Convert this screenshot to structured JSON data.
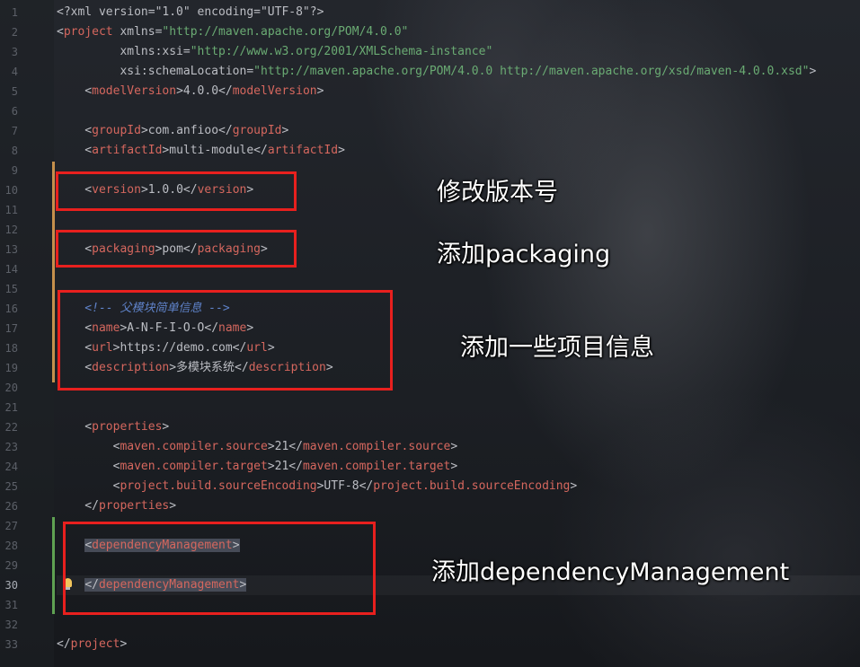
{
  "editor": {
    "active_line": 30,
    "lines": [
      {
        "n": "1",
        "t": [
          {
            "c": "xd",
            "s": "<?xml version=\"1.0\" encoding=\"UTF-8\"?>"
          }
        ]
      },
      {
        "n": "2",
        "t": [
          {
            "c": "xd",
            "s": "<"
          },
          {
            "c": "tag",
            "s": "project"
          },
          {
            "c": "attr",
            "s": " xmlns="
          },
          {
            "c": "val",
            "s": "\"http://maven.apache.org/POM/4.0.0\""
          }
        ]
      },
      {
        "n": "3",
        "t": [
          {
            "c": "attr",
            "s": "         xmlns:xsi="
          },
          {
            "c": "val",
            "s": "\"http://www.w3.org/2001/XMLSchema-instance\""
          }
        ]
      },
      {
        "n": "4",
        "t": [
          {
            "c": "attr",
            "s": "         xsi:schemaLocation="
          },
          {
            "c": "val",
            "s": "\"http://maven.apache.org/POM/4.0.0 http://maven.apache.org/xsd/maven-4.0.0.xsd\""
          },
          {
            "c": "xd",
            "s": ">"
          }
        ]
      },
      {
        "n": "5",
        "t": [
          {
            "c": "xd",
            "s": "    <"
          },
          {
            "c": "tag",
            "s": "modelVersion"
          },
          {
            "c": "xd",
            "s": ">4.0.0</"
          },
          {
            "c": "tag",
            "s": "modelVersion"
          },
          {
            "c": "xd",
            "s": ">"
          }
        ]
      },
      {
        "n": "6",
        "t": []
      },
      {
        "n": "7",
        "t": [
          {
            "c": "xd",
            "s": "    <"
          },
          {
            "c": "tag",
            "s": "groupId"
          },
          {
            "c": "xd",
            "s": ">com.anfioo</"
          },
          {
            "c": "tag",
            "s": "groupId"
          },
          {
            "c": "xd",
            "s": ">"
          }
        ]
      },
      {
        "n": "8",
        "t": [
          {
            "c": "xd",
            "s": "    <"
          },
          {
            "c": "tag",
            "s": "artifactId"
          },
          {
            "c": "xd",
            "s": ">multi-module</"
          },
          {
            "c": "tag",
            "s": "artifactId"
          },
          {
            "c": "xd",
            "s": ">"
          }
        ]
      },
      {
        "n": "9",
        "t": []
      },
      {
        "n": "10",
        "t": [
          {
            "c": "xd",
            "s": "    <"
          },
          {
            "c": "tag",
            "s": "version"
          },
          {
            "c": "xd",
            "s": ">1.0.0</"
          },
          {
            "c": "tag",
            "s": "version"
          },
          {
            "c": "xd",
            "s": ">"
          }
        ]
      },
      {
        "n": "11",
        "t": []
      },
      {
        "n": "12",
        "t": []
      },
      {
        "n": "13",
        "t": [
          {
            "c": "xd",
            "s": "    <"
          },
          {
            "c": "tag",
            "s": "packaging"
          },
          {
            "c": "xd",
            "s": ">pom</"
          },
          {
            "c": "tag",
            "s": "packaging"
          },
          {
            "c": "xd",
            "s": ">"
          }
        ]
      },
      {
        "n": "14",
        "t": []
      },
      {
        "n": "15",
        "t": []
      },
      {
        "n": "16",
        "t": [
          {
            "c": "com",
            "s": "    <!-- 父模块简单信息 -->"
          }
        ]
      },
      {
        "n": "17",
        "t": [
          {
            "c": "xd",
            "s": "    <"
          },
          {
            "c": "tag",
            "s": "name"
          },
          {
            "c": "xd",
            "s": ">A-N-F-I-O-O</"
          },
          {
            "c": "tag",
            "s": "name"
          },
          {
            "c": "xd",
            "s": ">"
          }
        ]
      },
      {
        "n": "18",
        "t": [
          {
            "c": "xd",
            "s": "    <"
          },
          {
            "c": "tag",
            "s": "url"
          },
          {
            "c": "xd",
            "s": ">https://demo.com</"
          },
          {
            "c": "tag",
            "s": "url"
          },
          {
            "c": "xd",
            "s": ">"
          }
        ]
      },
      {
        "n": "19",
        "t": [
          {
            "c": "xd",
            "s": "    <"
          },
          {
            "c": "tag",
            "s": "description"
          },
          {
            "c": "xd",
            "s": ">多模块系统</"
          },
          {
            "c": "tag",
            "s": "description"
          },
          {
            "c": "xd",
            "s": ">"
          }
        ]
      },
      {
        "n": "20",
        "t": []
      },
      {
        "n": "21",
        "t": []
      },
      {
        "n": "22",
        "t": [
          {
            "c": "xd",
            "s": "    <"
          },
          {
            "c": "tag",
            "s": "properties"
          },
          {
            "c": "xd",
            "s": ">"
          }
        ]
      },
      {
        "n": "23",
        "t": [
          {
            "c": "xd",
            "s": "        <"
          },
          {
            "c": "tag",
            "s": "maven.compiler.source"
          },
          {
            "c": "xd",
            "s": ">21</"
          },
          {
            "c": "tag",
            "s": "maven.compiler.source"
          },
          {
            "c": "xd",
            "s": ">"
          }
        ]
      },
      {
        "n": "24",
        "t": [
          {
            "c": "xd",
            "s": "        <"
          },
          {
            "c": "tag",
            "s": "maven.compiler.target"
          },
          {
            "c": "xd",
            "s": ">21</"
          },
          {
            "c": "tag",
            "s": "maven.compiler.target"
          },
          {
            "c": "xd",
            "s": ">"
          }
        ]
      },
      {
        "n": "25",
        "t": [
          {
            "c": "xd",
            "s": "        <"
          },
          {
            "c": "tag",
            "s": "project.build.sourceEncoding"
          },
          {
            "c": "xd",
            "s": ">UTF-8</"
          },
          {
            "c": "tag",
            "s": "project.build.sourceEncoding"
          },
          {
            "c": "xd",
            "s": ">"
          }
        ]
      },
      {
        "n": "26",
        "t": [
          {
            "c": "xd",
            "s": "    </"
          },
          {
            "c": "tag",
            "s": "properties"
          },
          {
            "c": "xd",
            "s": ">"
          }
        ]
      },
      {
        "n": "27",
        "t": []
      },
      {
        "n": "28",
        "t": [
          {
            "c": "xd",
            "s": "    "
          },
          {
            "c": "xd",
            "s": "<",
            "sel": true
          },
          {
            "c": "tag",
            "s": "dependencyManagement",
            "sel": true
          },
          {
            "c": "xd",
            "s": ">",
            "sel": true
          }
        ]
      },
      {
        "n": "29",
        "t": []
      },
      {
        "n": "30",
        "t": [
          {
            "c": "xd",
            "s": "    "
          },
          {
            "c": "xd",
            "s": "</",
            "sel": true
          },
          {
            "c": "tag",
            "s": "dependencyManagement",
            "sel": true
          },
          {
            "c": "xd",
            "s": ">",
            "sel": true
          }
        ]
      },
      {
        "n": "31",
        "t": []
      },
      {
        "n": "32",
        "t": []
      },
      {
        "n": "33",
        "t": [
          {
            "c": "xd",
            "s": "</"
          },
          {
            "c": "tag",
            "s": "project"
          },
          {
            "c": "xd",
            "s": ">"
          }
        ]
      }
    ]
  },
  "colors": {
    "tag": "#d5675e",
    "value": "#6aab73",
    "comment": "#5f82c9",
    "text": "#bcbec4",
    "annotation_box": "#e8201e",
    "changed_bar": "#c5904c",
    "added_bar": "#5fa152"
  },
  "annotations": {
    "version": "修改版本号",
    "packaging": "添加packaging",
    "info": "添加一些项目信息",
    "dependency_management": "添加dependencyManagement"
  },
  "icons": {
    "gutter_intention": "lightbulb-icon"
  }
}
